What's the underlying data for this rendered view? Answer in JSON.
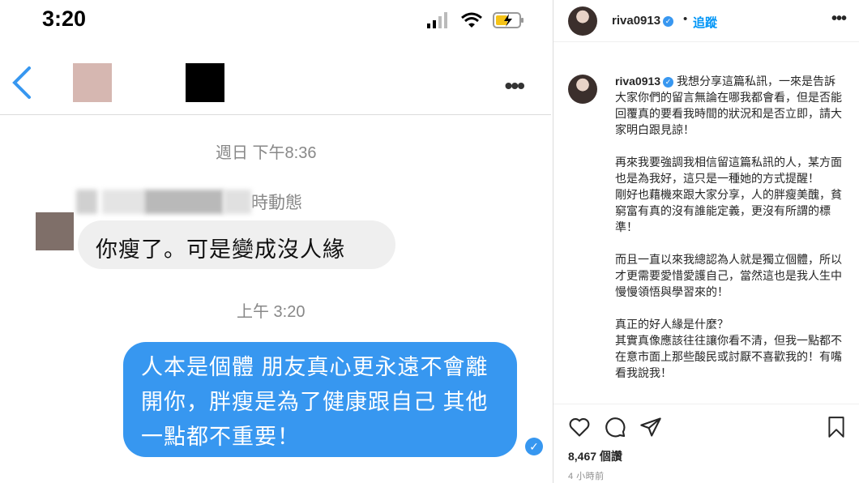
{
  "phone": {
    "status_time": "3:20",
    "timestamp_1": "週日 下午8:36",
    "reply_suffix": "時動態",
    "incoming_message": "你瘦了。可是變成沒人緣",
    "timestamp_2": "上午 3:20",
    "outgoing_message": "人本是個體 朋友真心更永遠不會離開你，胖瘦是為了健康跟自己 其他一點都不重要！"
  },
  "post": {
    "username": "riva0913",
    "follow_label": "追蹤",
    "caption": "我想分享這篇私訊，一來是告訴大家你們的留言無論在哪我都會看，但是否能回覆真的要看我時間的狀況和是否立即，請大家明白跟見諒！\n\n再來我要強調我相信留這篇私訊的人，某方面也是為我好，這只是一種她的方式提醒！\n剛好也藉機來跟大家分享，人的胖瘦美醜，貧窮富有真的沒有誰能定義，更沒有所謂的標準！\n\n而且一直以來我總認為人就是獨立個體，所以才更需要愛惜愛護自己，當然這也是我人生中慢慢領悟與學習來的！\n\n真正的好人緣是什麼？\n其實真像應該往往讓你看不清，但我一點都不在意市面上那些酸民或討厭不喜歡我的！有嘴看我說我！",
    "likes": "8,467 個讚",
    "time_ago": "4 小時前"
  },
  "colors": {
    "bubble_out": "#3797f0",
    "bubble_in": "#efefef",
    "ig_blue": "#0095f6"
  }
}
